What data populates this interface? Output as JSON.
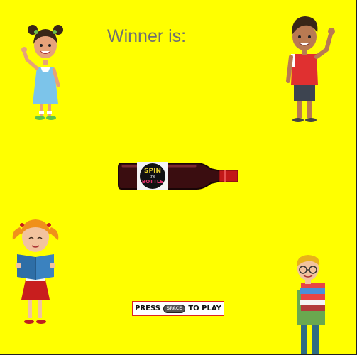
{
  "game": {
    "winner_label": "Winner is:",
    "winner_name": "",
    "prompt_press": "PRESS",
    "prompt_key": "SPACE",
    "prompt_action": "TO PLAY"
  },
  "bottle": {
    "label_line1": "SPIN",
    "label_line2": "the",
    "label_line3": "BOTTLE"
  },
  "colors": {
    "background": "#ffff00",
    "winner_text": "#707070",
    "hint_border": "#dd2222"
  }
}
